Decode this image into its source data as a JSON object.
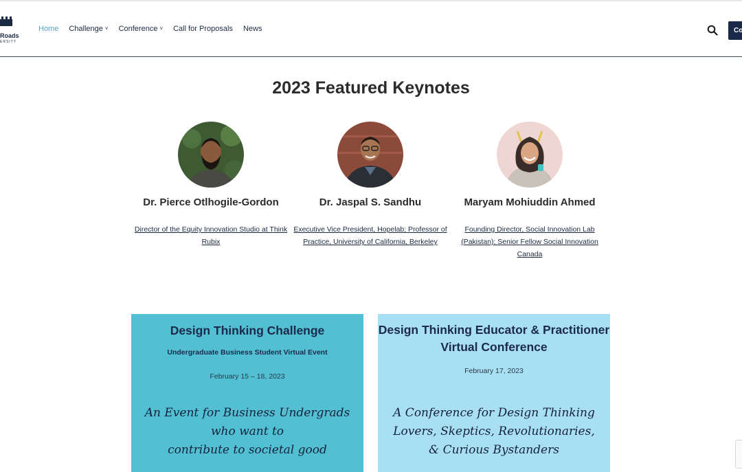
{
  "header": {
    "logo": {
      "word1": "Roads",
      "word2": "ERSITY"
    },
    "nav": [
      {
        "label": "Home",
        "active": true,
        "dropdown": false
      },
      {
        "label": "Challenge",
        "active": false,
        "dropdown": true
      },
      {
        "label": "Conference",
        "active": false,
        "dropdown": true
      },
      {
        "label": "Call for Proposals",
        "active": false,
        "dropdown": false
      },
      {
        "label": "News",
        "active": false,
        "dropdown": false
      }
    ],
    "search_icon": "search-icon",
    "cta_label": "Co",
    "chevron": "˅"
  },
  "keynotes": {
    "title": "2023 Featured Keynotes",
    "speakers": [
      {
        "name": "Dr. Pierce Otlhogile-Gordon",
        "title": "Director of the Equity Innovation Studio at Think Rubix"
      },
      {
        "name": "Dr. Jaspal S. Sandhu",
        "title": "Executive Vice President, Hopelab; Professor of Practice, University of California, Berkeley"
      },
      {
        "name": "Maryam Mohiuddin Ahmed",
        "title": "Founding Director, Social Innovation Lab (Pakistan); Senior Fellow Social Innovation Canada"
      }
    ]
  },
  "cards": {
    "challenge": {
      "title": "Design Thinking Challenge",
      "subtitle": "Undergraduate Business Student Virtual Event",
      "date": "February 15 – 18, 2023",
      "script_lines": [
        "An Event for Business Undergrads who want to",
        "contribute to societal good"
      ]
    },
    "conference": {
      "title_line1": "Design Thinking Educator & Practitioner",
      "title_line2": "Virtual Conference",
      "date": "February 17, 2023",
      "script_lines": [
        "A Conference for Design Thinking",
        "Lovers, Skeptics, Revolutionaries,",
        "& Curious Bystanders"
      ]
    }
  },
  "colors": {
    "accent": "#4aa6c9",
    "navy": "#1b2a4a",
    "card_left": "#52bfd3",
    "card_right": "#a8dff2"
  }
}
